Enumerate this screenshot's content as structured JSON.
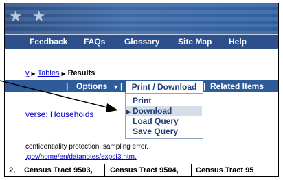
{
  "nav": {
    "items": [
      "Feedback",
      "FAQs",
      "Glossary",
      "Site Map",
      "Help"
    ]
  },
  "breadcrumb": {
    "prev": "y",
    "tables": "Tables",
    "current": "Results"
  },
  "toolbar": {
    "options": "Options",
    "print_download": "Print / Download",
    "related": "Related Items"
  },
  "dropdown": {
    "items": [
      "Print",
      "Download",
      "Load Query",
      "Save Query"
    ],
    "selected": "Download"
  },
  "universe": {
    "text": "verse: Households"
  },
  "notes": {
    "line1": "confidentiality protection, sampling error,",
    "line2": ".gov/home/en/datanotes/expsf3.htm."
  },
  "table": {
    "headers": [
      "2,",
      "Census Tract 9503,",
      "Census Tract 9504,",
      "Census Tract 95"
    ]
  }
}
